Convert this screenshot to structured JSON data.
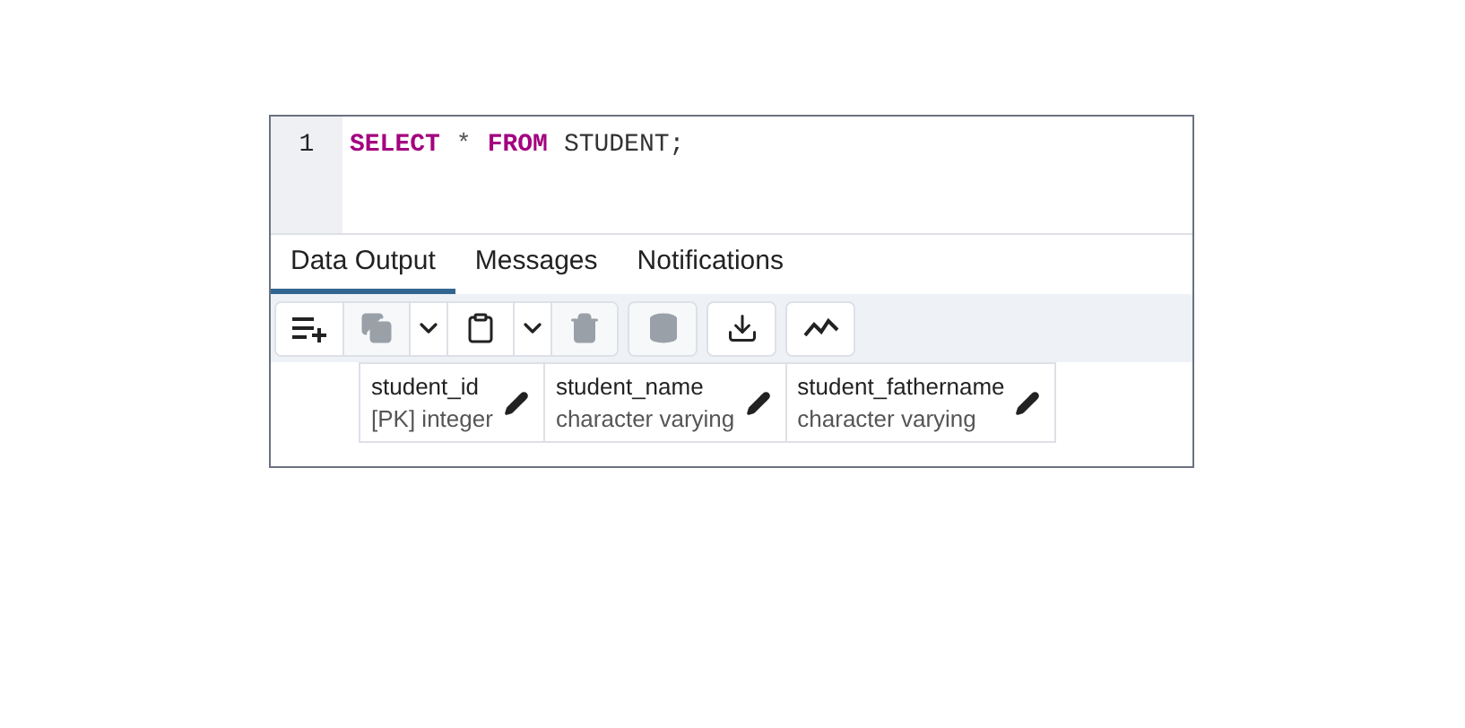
{
  "editor": {
    "lines": [
      {
        "number": "1",
        "tokens": [
          {
            "kind": "keyword",
            "text": "SELECT"
          },
          {
            "kind": "operator",
            "text": "*"
          },
          {
            "kind": "keyword",
            "text": "FROM"
          },
          {
            "kind": "ident",
            "text": "STUDENT;"
          }
        ]
      }
    ]
  },
  "tabs": [
    {
      "label": "Data Output",
      "selected": true
    },
    {
      "label": "Messages",
      "selected": false
    },
    {
      "label": "Notifications",
      "selected": false
    }
  ],
  "toolbar": {
    "groups": [
      {
        "buttons": [
          {
            "kind": "add-row",
            "disabled": false
          },
          {
            "kind": "copy",
            "disabled": true
          },
          {
            "kind": "dropdown",
            "disabled": false
          },
          {
            "kind": "paste",
            "disabled": false
          },
          {
            "kind": "dropdown",
            "disabled": false
          },
          {
            "kind": "delete",
            "disabled": true
          }
        ]
      },
      {
        "buttons": [
          {
            "kind": "save-data",
            "disabled": true
          }
        ]
      },
      {
        "buttons": [
          {
            "kind": "download",
            "disabled": false
          }
        ]
      },
      {
        "buttons": [
          {
            "kind": "graph",
            "disabled": false
          }
        ]
      }
    ]
  },
  "table": {
    "columns": [
      {
        "name": "student_id",
        "type": "[PK] integer"
      },
      {
        "name": "student_name",
        "type": "character varying"
      },
      {
        "name": "student_fathername",
        "type": "character varying"
      }
    ]
  }
}
